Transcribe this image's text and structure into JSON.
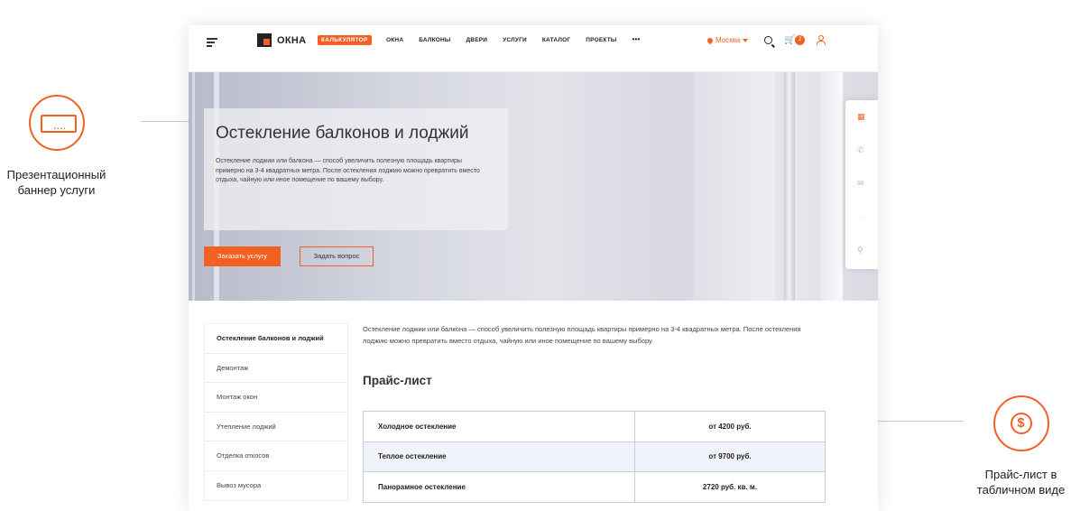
{
  "callouts": {
    "banner_label": "Презентационный баннер услуги",
    "banner_icon_glyph": "....",
    "price_label": "Прайс-лист в табличном виде",
    "price_icon_glyph": "$"
  },
  "colors": {
    "accent": "#f26122",
    "text": "#333333",
    "table_border": "#c9ccd6",
    "table_alt_row": "#f1f3fb"
  },
  "header": {
    "logo_text": "ОКНА",
    "calculator_badge": "КАЛЬКУЛЯТОР",
    "nav": [
      "ОКНА",
      "БАЛКОНЫ",
      "ДВЕРИ",
      "УСЛУГИ",
      "КАТАЛОГ",
      "ПРОЕКТЫ"
    ],
    "more": "•••",
    "city": "Москва",
    "cart_glyph": "🛒",
    "cart_count": "2"
  },
  "hero": {
    "title": "Остекление балконов и лоджий",
    "description": "Остекление лоджии или балкона — способ увеличить полезную площадь квартиры примерно на 3-4 квадратных метра. После остекления лоджию можно превратить вместо отдыха, чайную или иное помещение по вашему выбору.",
    "order_button": "Заказать услугу",
    "ask_button": "Задать вопрос"
  },
  "side_panel": {
    "icons": [
      "calculator-icon",
      "phone-icon",
      "mail-icon",
      "chat-icon",
      "location-icon"
    ],
    "glyphs": [
      "▦",
      "✆",
      "✉",
      "◌",
      "⚲"
    ]
  },
  "sidebar": {
    "items": [
      "Остекление балконов и лоджий",
      "Демонтаж",
      "Монтаж окон",
      "Утепление лоджий",
      "Отделка откосов",
      "Вывоз мусора"
    ]
  },
  "content": {
    "intro": "Остекление лоджии или балкона — способ увеличить полезную площадь квартиры примерно на 3-4 квадратных метра. После остекления лоджию можно превратить вместо отдыха, чайную или иное помещение по вашему выбору.",
    "price_title": "Прайс-лист",
    "price_rows": [
      {
        "name": "Холодное остекление",
        "price": "от 4200 руб."
      },
      {
        "name": "Теплое остекление",
        "price": "от 9700 руб."
      },
      {
        "name": "Панорамное остекление",
        "price": "2720 руб. кв. м."
      }
    ]
  }
}
